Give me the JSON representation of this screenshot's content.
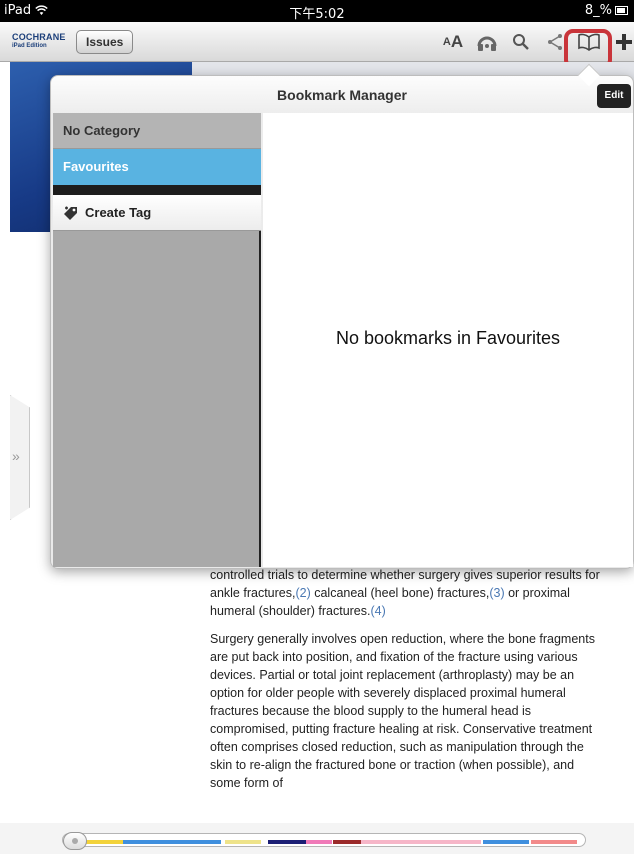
{
  "status_bar": {
    "device": "iPad",
    "time": "下午5:02",
    "battery_text": "8_%"
  },
  "toolbar": {
    "logo_line1": "COCHRANE",
    "logo_line2": "iPad Edition",
    "issues_label": "Issues",
    "font_size_small": "A",
    "font_size_big": "A",
    "icons": [
      "font-size-icon",
      "audio-icon",
      "search-icon",
      "share-icon",
      "bookmark-icon",
      "add-icon"
    ]
  },
  "bookmark_manager": {
    "title": "Bookmark Manager",
    "edit_label": "Edit",
    "categories": [
      {
        "label": "No Category",
        "selected": false
      },
      {
        "label": "Favourites",
        "selected": true
      }
    ],
    "create_tag_label": "Create Tag",
    "empty_message": "No bookmarks in Favourites"
  },
  "article": {
    "p1_a": "controlled trials to determine whether surgery gives superior results for ankle fractures,",
    "p1_ref2": "(2)",
    "p1_b": " calcaneal (heel bone) fractures,",
    "p1_ref3": "(3)",
    "p1_c": " or proximal humeral (shoulder) fractures.",
    "p1_ref4": "(4)",
    "p2": "Surgery generally involves open reduction, where the bone fragments are put back into position, and fixation of the fracture using various devices. Partial or total joint replacement (arthroplasty) may be an option for older people with severely displaced proximal humeral fractures because the blood supply to the humeral head is compromised, putting fracture healing at risk. Conservative treatment often comprises closed reduction, such as manipulation through the skin to re-align the fractured bone or traction (when possible), and some form of"
  },
  "colors": {
    "accent_selected": "#59b3e1",
    "highlight_box": "#c9343a",
    "link": "#4a78b3"
  },
  "side_tab_glyph": "»"
}
